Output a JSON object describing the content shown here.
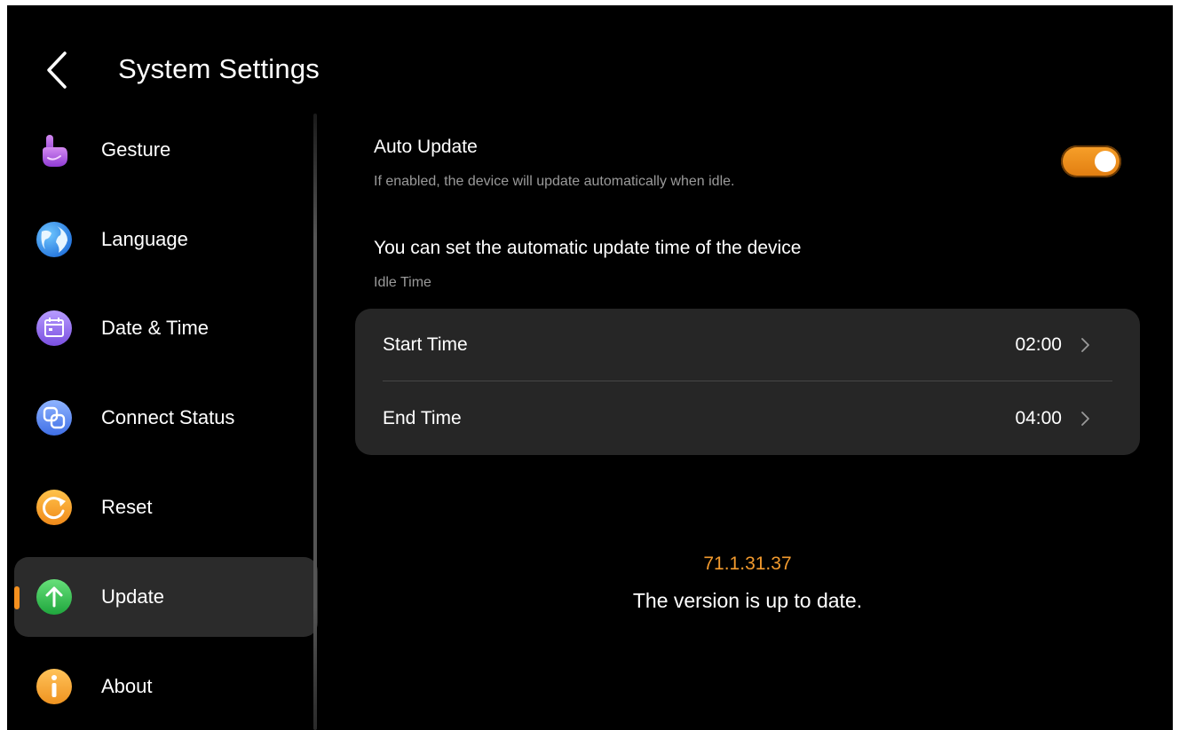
{
  "header": {
    "title": "System Settings",
    "back_icon": "chevron-left-icon"
  },
  "sidebar": {
    "selected_index": 5,
    "accent_color": "#f5901e",
    "items": [
      {
        "label": "Gesture",
        "icon": "hand-pointer-icon"
      },
      {
        "label": "Language",
        "icon": "globe-icon"
      },
      {
        "label": "Date & Time",
        "icon": "calendar-icon"
      },
      {
        "label": "Connect Status",
        "icon": "link-squares-icon"
      },
      {
        "label": "Reset",
        "icon": "reset-icon"
      },
      {
        "label": "Update",
        "icon": "arrow-up-circle-icon"
      },
      {
        "label": "About",
        "icon": "info-icon"
      }
    ]
  },
  "auto_update": {
    "title": "Auto Update",
    "description": "If enabled, the device will update automatically when idle.",
    "enabled": true,
    "toggle_color": "#f29a2e"
  },
  "schedule": {
    "heading": "You can set the automatic update time of the device",
    "subheading": "Idle Time",
    "start": {
      "label": "Start Time",
      "value": "02:00"
    },
    "end": {
      "label": "End Time",
      "value": "04:00"
    }
  },
  "version": {
    "number": "71.1.31.37",
    "status": "The version is up to date.",
    "number_color": "#f29a2e"
  }
}
